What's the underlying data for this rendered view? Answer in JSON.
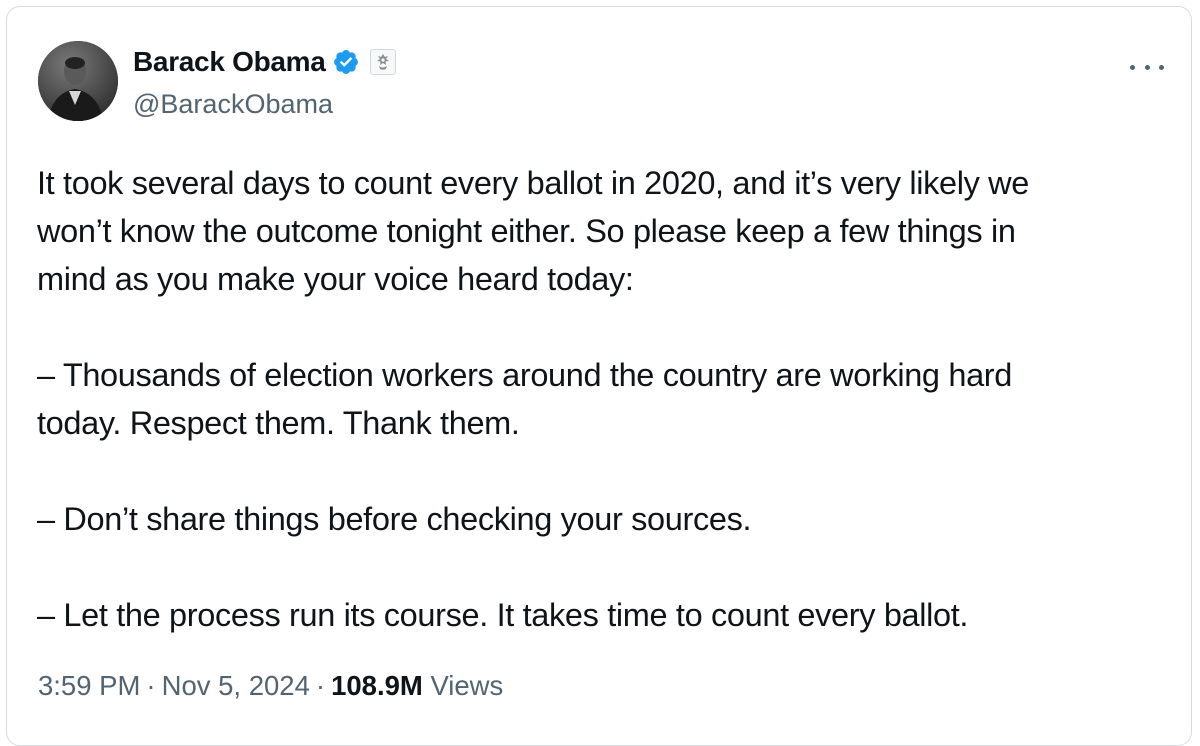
{
  "author": {
    "display_name": "Barack Obama",
    "handle": "@BarackObama",
    "verified_icon": "verified-badge-icon",
    "affiliation_icon": "government-seal-icon",
    "avatar_icon": "profile-photo"
  },
  "menu": {
    "icon": "more-options-icon"
  },
  "tweet": {
    "paragraphs": [
      "It took several days to count every ballot in 2020, and it’s very likely we\nwon’t know the outcome tonight either. So please keep a few things in\nmind as you make your voice heard today:",
      "– Thousands of election workers around the country are working hard\ntoday. Respect them. Thank them.",
      "– Don’t share things before checking your sources.",
      "– Let the process run its course. It takes time to count every ballot."
    ]
  },
  "meta": {
    "time": "3:59 PM",
    "date": "Nov 5, 2024",
    "separator": "·",
    "views_count": "108.9M",
    "views_label": "Views"
  },
  "colors": {
    "verified_blue": "#1d9bf0",
    "secondary_text": "#536471",
    "primary_text": "#0f1419",
    "border": "#d7dbdf"
  }
}
